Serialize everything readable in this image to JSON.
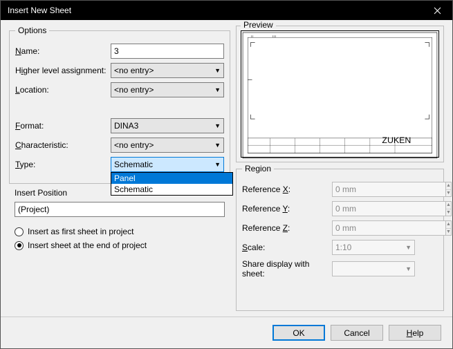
{
  "window": {
    "title": "Insert New Sheet"
  },
  "options": {
    "legend": "Options",
    "name_label": "Name:",
    "name_value": "3",
    "higher_label": "Higher level assignment:",
    "higher_value": "<no entry>",
    "location_label": "Location:",
    "location_value": "<no entry>",
    "format_label": "Format:",
    "format_value": "DINA3",
    "characteristic_label": "Characteristic:",
    "characteristic_value": "<no entry>",
    "type_label": "Type:",
    "type_value": "Schematic",
    "type_options": [
      "Panel",
      "Schematic"
    ]
  },
  "insert_position": {
    "legend": "Insert Position",
    "project_text": "(Project)",
    "radio_first": "Insert as first sheet in project",
    "radio_end": "Insert sheet at the end of project"
  },
  "preview": {
    "legend": "Preview",
    "brand": "ZUKEN"
  },
  "region": {
    "legend": "Region",
    "ref_x_label": "Reference X:",
    "ref_x_value": "0 mm",
    "ref_y_label": "Reference Y:",
    "ref_y_value": "0 mm",
    "ref_z_label": "Reference Z:",
    "ref_z_value": "0 mm",
    "scale_label": "Scale:",
    "scale_value": "1:10",
    "share_label": "Share display with sheet:",
    "share_value": ""
  },
  "buttons": {
    "ok": "OK",
    "cancel": "Cancel",
    "help": "Help"
  }
}
